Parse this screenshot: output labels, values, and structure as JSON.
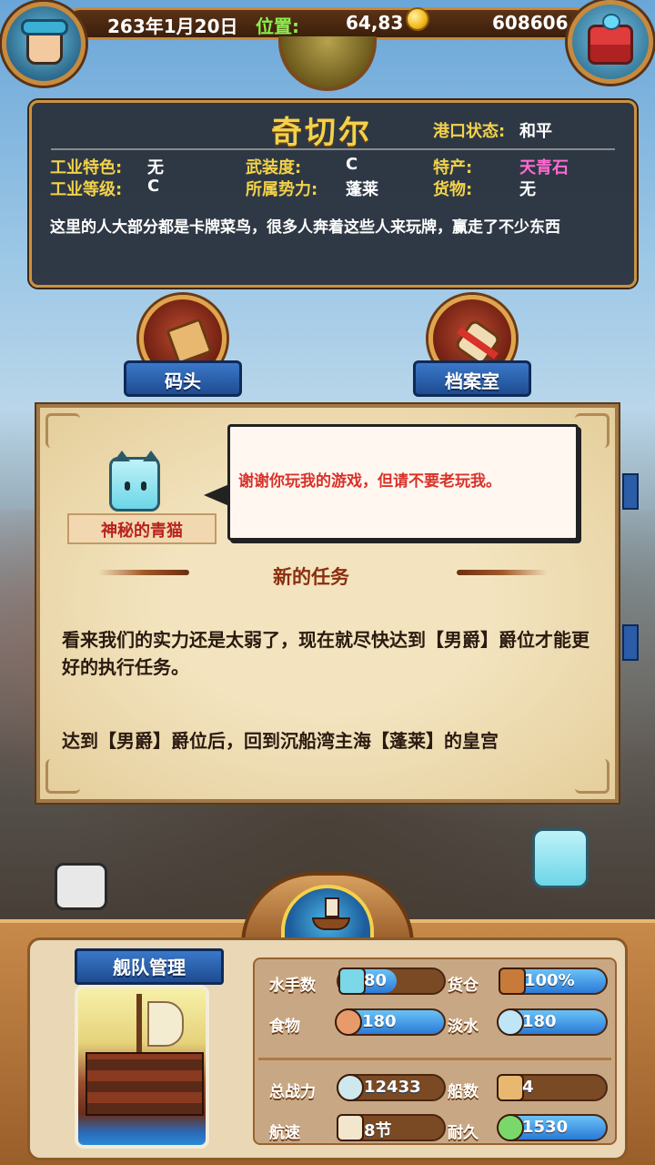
{
  "topbar": {
    "date": "263年1月20日",
    "position_label": "位置:",
    "position_value": "64,83",
    "gold": "608606"
  },
  "port": {
    "name": "奇切尔",
    "status_label": "港口状态:",
    "status_value": "和平",
    "industry_feature_label": "工业特色:",
    "industry_feature_value": "无",
    "industry_level_label": "工业等级:",
    "industry_level_value": "C",
    "armament_label": "武装度:",
    "armament_value": "C",
    "faction_label": "所属势力:",
    "faction_value": "蓬莱",
    "specialty_label": "特产:",
    "specialty_value": "天青石",
    "specialty_color": "#ff6ad2",
    "goods_label": "货物:",
    "goods_value": "无",
    "description": "这里的人大部分都是卡牌菜鸟，很多人奔着这些人来玩牌，赢走了不少东西"
  },
  "buttons": {
    "dock_label": "码头",
    "archive_label": "档案室"
  },
  "quest": {
    "npc_name": "神秘的青猫",
    "speech": "谢谢你玩我的游戏，但请不要老玩我。",
    "title": "新的任务",
    "body": "看来我们的实力还是太弱了，现在就尽快达到【男爵】爵位才能更好的执行任务。",
    "goal": "达到【男爵】爵位后，回到沉船湾主海【蓬莱】的皇宫"
  },
  "fleet": {
    "title": "舰队管理",
    "stats": [
      {
        "label": "水手数",
        "value": "80",
        "fill": 0.55
      },
      {
        "label": "货仓",
        "value": "100%",
        "fill": 1.0
      },
      {
        "label": "食物",
        "value": "180",
        "fill": 1.0
      },
      {
        "label": "淡水",
        "value": "180",
        "fill": 1.0
      },
      {
        "label": "总战力",
        "value": "12433",
        "fill": 0
      },
      {
        "label": "船数",
        "value": "4",
        "fill": 0
      },
      {
        "label": "航速",
        "value": "8节",
        "fill": 0
      },
      {
        "label": "耐久",
        "value": "1530",
        "fill": 1.0
      }
    ]
  }
}
